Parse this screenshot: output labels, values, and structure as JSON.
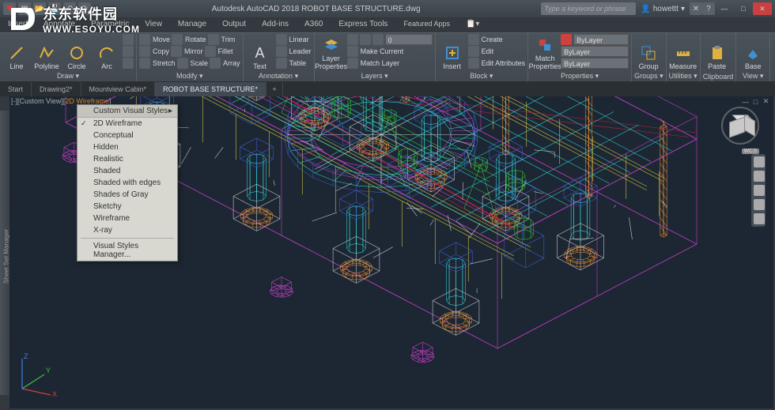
{
  "app": {
    "title": "Autodesk AutoCAD 2018     ROBOT BASE STRUCTURE.dwg",
    "search_placeholder": "Type a keyword or phrase",
    "user": "howettt"
  },
  "ribbon_tabs": [
    "Insert",
    "Annotate",
    "Parametric",
    "View",
    "Manage",
    "Output",
    "Add-ins",
    "A360",
    "Express Tools",
    "Featured Apps"
  ],
  "ribbon": {
    "draw": {
      "title": "Draw ▾",
      "btn1": "Line",
      "btn2": "Polyline",
      "btn3": "Circle",
      "btn4": "Arc"
    },
    "modify": {
      "title": "Modify ▾",
      "r1a": "Move",
      "r1b": "Rotate",
      "r1c": "Trim",
      "r2a": "Copy",
      "r2b": "Mirror",
      "r2c": "Fillet",
      "r3a": "Stretch",
      "r3b": "Scale",
      "r3c": "Array"
    },
    "annotation": {
      "title": "Annotation ▾",
      "btn1": "Text",
      "r1": "Linear",
      "r2": "Leader",
      "r3": "Table"
    },
    "layers": {
      "title": "Layers ▾",
      "btn": "Layer\nProperties",
      "r1": "Make Current",
      "r2": "Match Layer",
      "field": "0"
    },
    "block": {
      "title": "Block ▾",
      "btn": "Insert",
      "r1": "Create",
      "r2": "Edit",
      "r3": "Edit Attributes"
    },
    "properties": {
      "title": "Properties ▾",
      "btn": "Match\nProperties",
      "f1": "ByLayer",
      "f2": "ByLayer",
      "f3": "ByLayer"
    },
    "groups": {
      "title": "Groups ▾",
      "btn": "Group"
    },
    "utilities": {
      "title": "Utilities ▾",
      "btn": "Measure"
    },
    "clipboard": {
      "title": "Clipboard",
      "btn": "Paste"
    },
    "view": {
      "title": "View ▾",
      "btn": "Base"
    }
  },
  "filetabs": [
    "Start",
    "Drawing2*",
    "Mountview Cabin*",
    "ROBOT BASE STRUCTURE*"
  ],
  "viewlabel": {
    "prefix": "[-][Custom View][",
    "style": "2D Wireframe",
    "suffix": "]"
  },
  "ctxmenu": {
    "header": "Custom Visual Styles",
    "items": [
      "2D Wireframe",
      "Conceptual",
      "Hidden",
      "Realistic",
      "Shaded",
      "Shaded with edges",
      "Shades of Gray",
      "Sketchy",
      "Wireframe",
      "X-ray"
    ],
    "footer": "Visual Styles Manager...",
    "checked": 0
  },
  "sidebar_label": "Sheet Set Manager",
  "ucs": {
    "x": "X",
    "y": "Y",
    "z": "Z"
  },
  "viewcube": {
    "wcs": "WCS"
  },
  "watermark": {
    "cn": "东东软件园",
    "en": "WWW.ESOYU.COM"
  }
}
